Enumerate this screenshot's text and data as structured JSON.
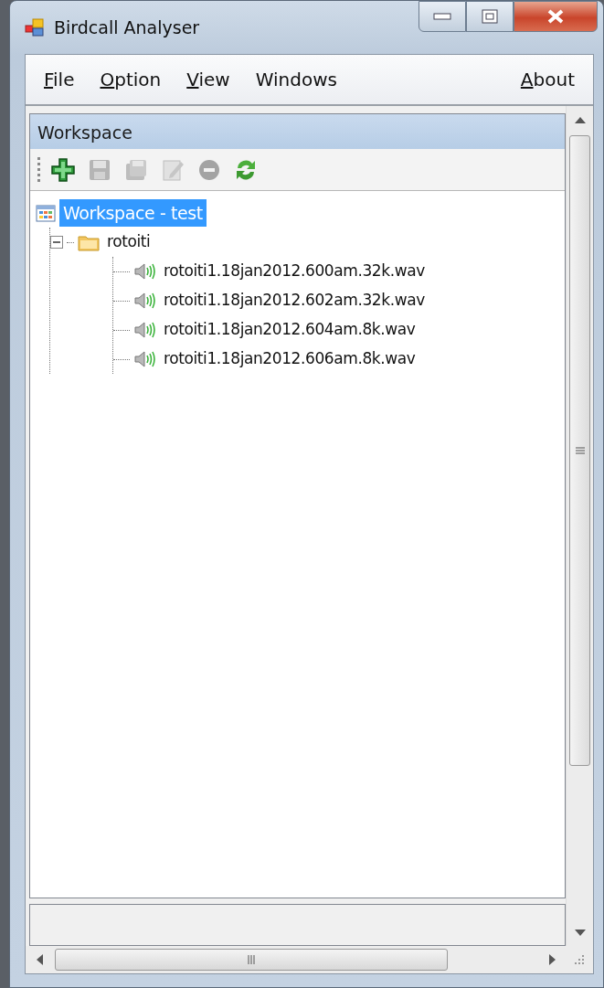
{
  "window": {
    "title": "Birdcall Analyser"
  },
  "menu": [
    {
      "label": "File",
      "underline": true
    },
    {
      "label": "Option",
      "underline": true
    },
    {
      "label": "View",
      "underline": true
    },
    {
      "label": "Windows",
      "underline": false
    },
    {
      "label": "About",
      "underline": true
    }
  ],
  "panel": {
    "title": "Workspace"
  },
  "toolbar": [
    {
      "kind": "add",
      "disabled": false
    },
    {
      "kind": "save",
      "disabled": true
    },
    {
      "kind": "save-all",
      "disabled": true
    },
    {
      "kind": "edit",
      "disabled": true
    },
    {
      "kind": "remove",
      "disabled": true
    },
    {
      "kind": "refresh",
      "disabled": false
    }
  ],
  "tree": [
    {
      "kind": "workspace",
      "label": "Workspace - test",
      "selected": true,
      "children": [
        {
          "kind": "folder",
          "label": "rotoiti",
          "selected": false,
          "expanded": true,
          "children": [
            {
              "kind": "audio",
              "label": "rotoiti1.18jan2012.600am.32k.wav",
              "selected": false
            },
            {
              "kind": "audio",
              "label": "rotoiti1.18jan2012.602am.32k.wav",
              "selected": false
            },
            {
              "kind": "audio",
              "label": "rotoiti1.18jan2012.604am.8k.wav",
              "selected": false
            },
            {
              "kind": "audio",
              "label": "rotoiti1.18jan2012.606am.8k.wav",
              "selected": false
            }
          ]
        }
      ]
    }
  ]
}
